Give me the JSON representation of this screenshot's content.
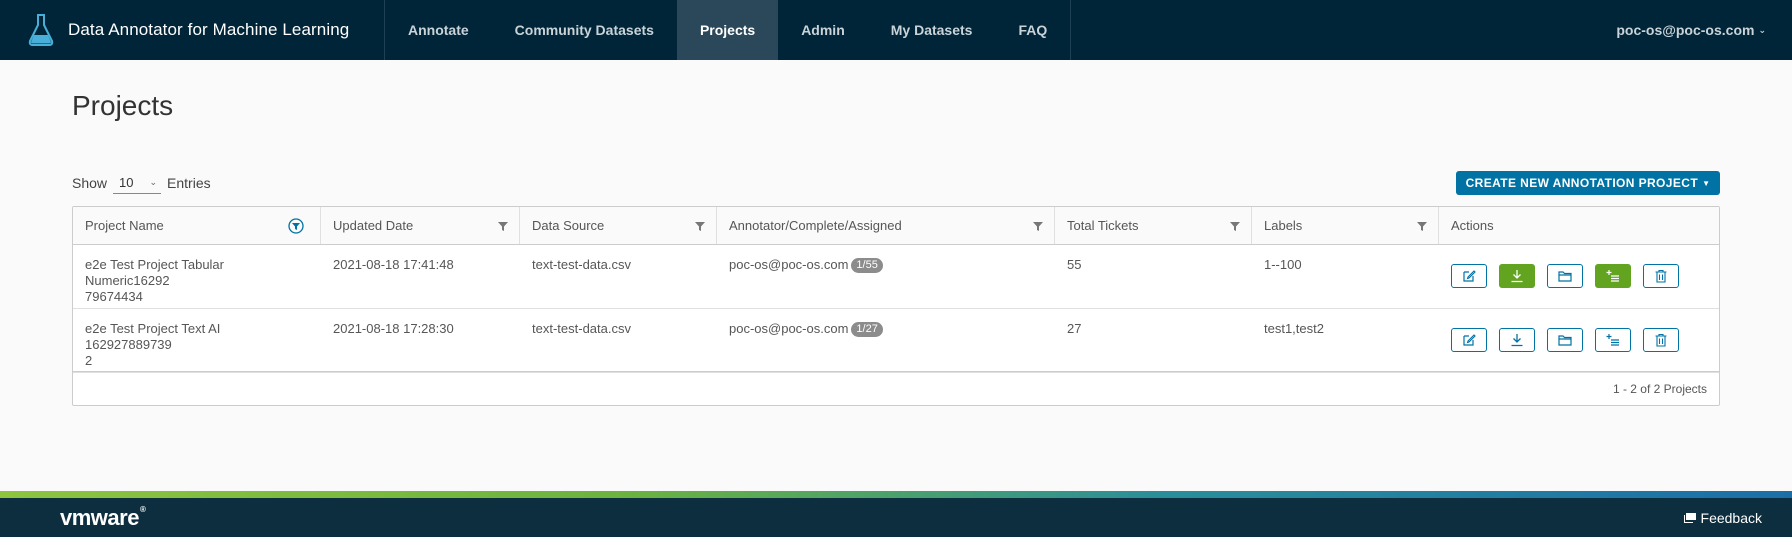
{
  "header": {
    "title": "Data Annotator for Machine Learning",
    "logo_icon": "flask-icon",
    "nav": [
      {
        "label": "Annotate",
        "active": false
      },
      {
        "label": "Community Datasets",
        "active": false
      },
      {
        "label": "Projects",
        "active": true
      },
      {
        "label": "Admin",
        "active": false
      },
      {
        "label": "My Datasets",
        "active": false
      },
      {
        "label": "FAQ",
        "active": false
      }
    ],
    "user": "poc-os@poc-os.com"
  },
  "page": {
    "title": "Projects",
    "show_label": "Show",
    "entries_value": "10",
    "entries_label": "Entries",
    "create_button": "CREATE NEW ANNOTATION PROJECT"
  },
  "table": {
    "columns": [
      "Project Name",
      "Updated Date",
      "Data Source",
      "Annotator/Complete/Assigned",
      "Total Tickets",
      "Labels",
      "Actions"
    ],
    "rows": [
      {
        "name_line1": "e2e Test Project Tabular Numeric16292",
        "name_line2": "79674434",
        "updated": "2021-08-18 17:41:48",
        "source": "text-test-data.csv",
        "annotator": "poc-os@poc-os.com",
        "progress": "1/55",
        "tickets": "55",
        "labels": "1--100",
        "download_enabled": true,
        "append_enabled": true
      },
      {
        "name_line1": "e2e Test Project Text AI 162927889739",
        "name_line2": "2",
        "updated": "2021-08-18 17:28:30",
        "source": "text-test-data.csv",
        "annotator": "poc-os@poc-os.com",
        "progress": "1/27",
        "tickets": "27",
        "labels": "test1,test2",
        "download_enabled": false,
        "append_enabled": false
      }
    ],
    "footer": "1 - 2 of 2 Projects"
  },
  "footer": {
    "brand": "vmware",
    "feedback": "Feedback"
  },
  "colors": {
    "header_bg": "#002538",
    "accent": "#0072a3",
    "success": "#62a420",
    "footer_bg": "#0d2e3f"
  }
}
